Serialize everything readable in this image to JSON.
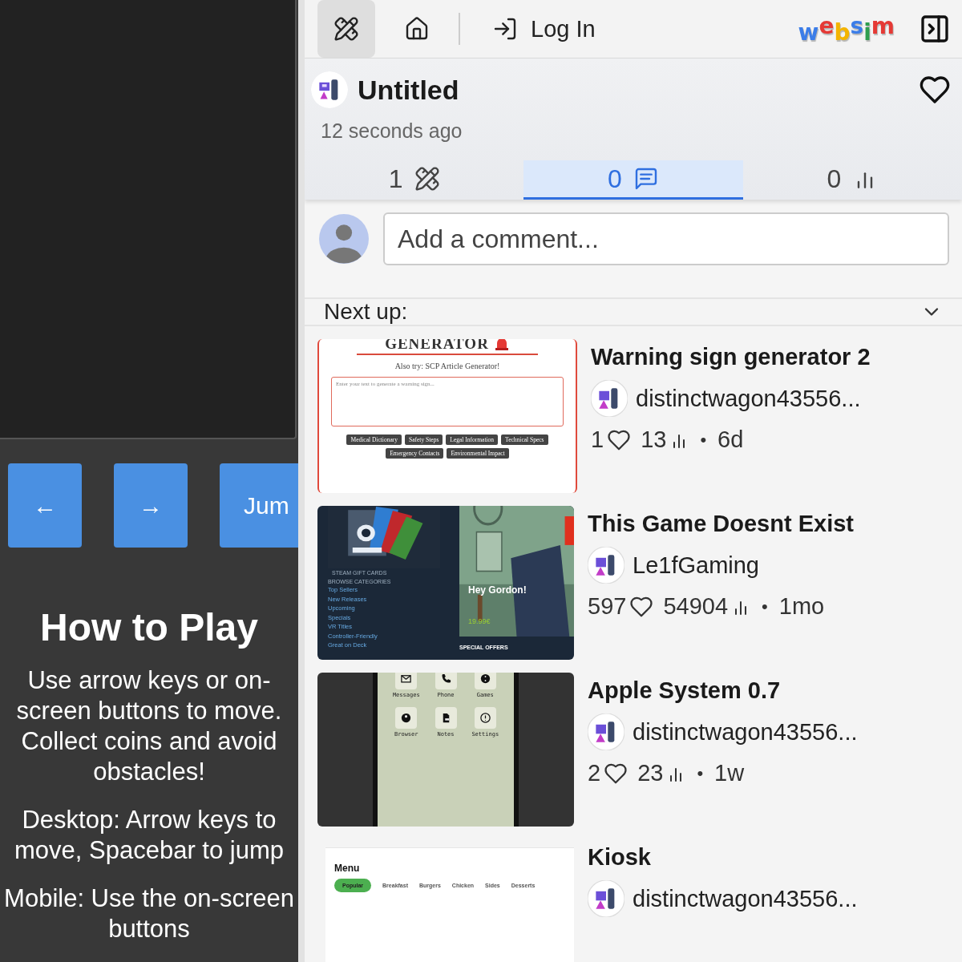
{
  "game": {
    "buttons": [
      "←",
      "→",
      "Jum"
    ],
    "heading": "How to Play",
    "paragraphs": [
      "Use arrow keys or on-screen buttons to move. Collect coins and avoid obstacles!",
      "Desktop: Arrow keys to move, Spacebar to jump",
      "Mobile: Use the on-screen buttons"
    ]
  },
  "topbar": {
    "login": "Log In",
    "logo": [
      {
        "letter": "w",
        "color": "#3b7de8"
      },
      {
        "letter": "e",
        "color": "#e53935"
      },
      {
        "letter": "b",
        "color": "#f4b400"
      },
      {
        "letter": "s",
        "color": "#3b7de8"
      },
      {
        "letter": "i",
        "color": "#2e9e4f"
      },
      {
        "letter": "m",
        "color": "#e53935"
      }
    ]
  },
  "project": {
    "title": "Untitled",
    "time": "12 seconds ago",
    "stats": [
      {
        "kind": "remixes",
        "count": "1",
        "selected": false
      },
      {
        "kind": "comments",
        "count": "0",
        "selected": true
      },
      {
        "kind": "views",
        "count": "0",
        "selected": false
      }
    ]
  },
  "comment": {
    "placeholder": "Add a comment..."
  },
  "next_up": {
    "label": "Next up:"
  },
  "cards": [
    {
      "title": "Warning sign generator 2",
      "author": "distinctwagon43556...",
      "likes": "1",
      "views": "13",
      "sep": "•",
      "age": "6d",
      "thumb": {
        "kind": "warning",
        "heading": "GENERATOR",
        "also": "Also try: SCP Article Generator!",
        "placeholder": "Enter your text to generate a warning sign...",
        "chips": [
          "Medical Dictionary",
          "Safety Steps",
          "Legal Information",
          "Technical Specs",
          "Emergency Contacts",
          "Environmental Impact"
        ]
      }
    },
    {
      "title": "This Game Doesnt Exist",
      "author": "Le1fGaming",
      "likes": "597",
      "views": "54904",
      "sep": "•",
      "age": "1mo",
      "thumb": {
        "kind": "steam",
        "caption": "STEAM GIFT CARDS",
        "section": "BROWSE CATEGORIES",
        "links": [
          "Top Sellers",
          "New Releases",
          "Upcoming",
          "Specials",
          "VR Titles",
          "Controller-Friendly",
          "Great on Deck"
        ],
        "feature": "Hey Gordon!",
        "price": "19.99€",
        "offers": "SPECIAL OFFERS"
      }
    },
    {
      "title": "Apple System 0.7",
      "author": "distinctwagon43556...",
      "likes": "2",
      "views": "23",
      "sep": "•",
      "age": "1w",
      "thumb": {
        "kind": "phone",
        "apps": [
          {
            "label": "Messages",
            "kind": "mail"
          },
          {
            "label": "Phone",
            "kind": "phone"
          },
          {
            "label": "Games",
            "kind": "games"
          },
          {
            "label": "Browser",
            "kind": "browser"
          },
          {
            "label": "Notes",
            "kind": "notes"
          },
          {
            "label": "Settings",
            "kind": "settings"
          }
        ]
      }
    },
    {
      "title": "Kiosk",
      "author": "distinctwagon43556...",
      "thumb": {
        "kind": "menu",
        "title": "Menu",
        "tabs": [
          {
            "label": "Popular",
            "selected": true
          },
          {
            "label": "Breakfast",
            "selected": false
          },
          {
            "label": "Burgers",
            "selected": false
          },
          {
            "label": "Chicken",
            "selected": false
          },
          {
            "label": "Sides",
            "selected": false
          },
          {
            "label": "Desserts",
            "selected": false
          }
        ]
      }
    }
  ]
}
